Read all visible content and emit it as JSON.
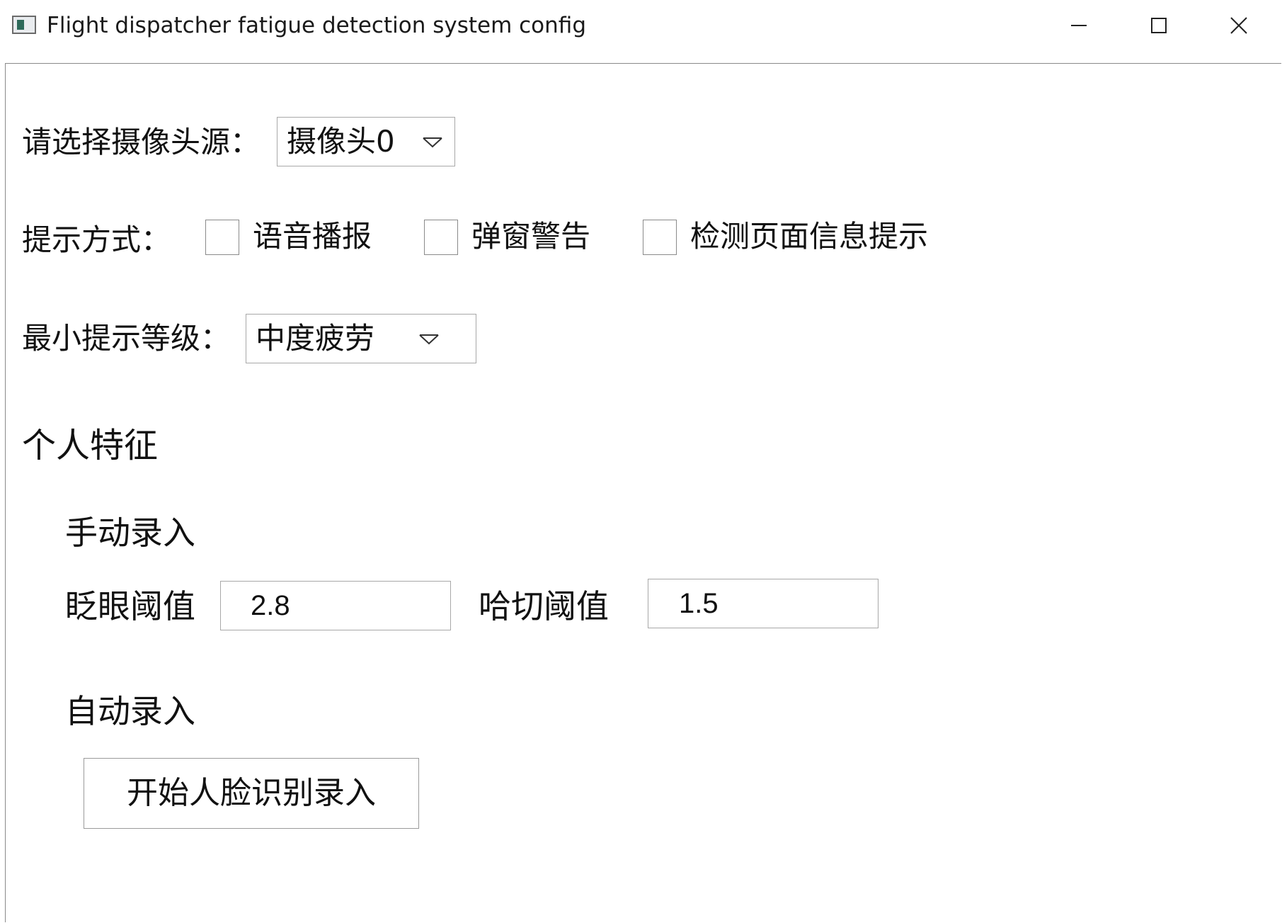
{
  "window": {
    "title": "Flight dispatcher fatigue detection system config"
  },
  "camera": {
    "label": "请选择摄像头源：",
    "selected": "摄像头0"
  },
  "notify": {
    "label": "提示方式：",
    "options": [
      {
        "label": "语音播报",
        "checked": false
      },
      {
        "label": "弹窗警告",
        "checked": false
      },
      {
        "label": "检测页面信息提示",
        "checked": false
      }
    ]
  },
  "level": {
    "label": "最小提示等级：",
    "selected": "中度疲劳"
  },
  "personal": {
    "heading": "个人特征",
    "manual": {
      "heading": "手动录入",
      "blink_label": "眨眼阈值",
      "blink_value": "2.8",
      "yawn_label": "哈切阈值",
      "yawn_value": "1.5"
    },
    "auto": {
      "heading": "自动录入",
      "button_label": "开始人脸识别录入"
    }
  },
  "icons": {
    "app": "app-window-icon",
    "minimize": "minimize-icon",
    "maximize": "maximize-icon",
    "close": "close-icon",
    "dropdown": "chevron-down-icon"
  }
}
